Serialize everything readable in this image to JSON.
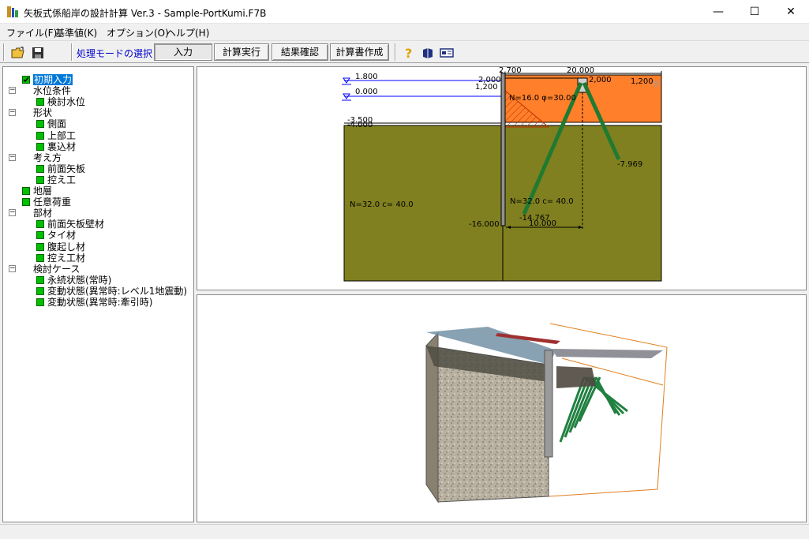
{
  "window": {
    "title": "矢板式係船岸の設計計算 Ver.3 - Sample-PortKumi.F7B",
    "minimize_glyph": "—",
    "maximize_glyph": "☐",
    "close_glyph": "✕"
  },
  "menu": [
    "ファイル(F)",
    "基準値(K)",
    "オプション(O)",
    "ヘルプ(H)"
  ],
  "toolbar": {
    "mode_label": "処理モードの選択",
    "buttons": [
      "入力",
      "計算実行",
      "結果確認",
      "計算書作成"
    ],
    "active_button": "入力"
  },
  "tree": [
    {
      "label": "初期入力",
      "level": 0,
      "type": "check",
      "selected": true
    },
    {
      "label": "水位条件",
      "level": 0,
      "type": "folder"
    },
    {
      "label": "検討水位",
      "level": 1,
      "type": "item"
    },
    {
      "label": "形状",
      "level": 0,
      "type": "folder"
    },
    {
      "label": "側面",
      "level": 1,
      "type": "item"
    },
    {
      "label": "上部工",
      "level": 1,
      "type": "item"
    },
    {
      "label": "裏込材",
      "level": 1,
      "type": "item"
    },
    {
      "label": "考え方",
      "level": 0,
      "type": "folder"
    },
    {
      "label": "前面矢板",
      "level": 1,
      "type": "item"
    },
    {
      "label": "控え工",
      "level": 1,
      "type": "item"
    },
    {
      "label": "地層",
      "level": 0,
      "type": "item"
    },
    {
      "label": "任意荷重",
      "level": 0,
      "type": "item"
    },
    {
      "label": "部材",
      "level": 0,
      "type": "folder"
    },
    {
      "label": "前面矢板壁材",
      "level": 1,
      "type": "item"
    },
    {
      "label": "タイ材",
      "level": 1,
      "type": "item"
    },
    {
      "label": "腹起し材",
      "level": 1,
      "type": "item"
    },
    {
      "label": "控え工材",
      "level": 1,
      "type": "item"
    },
    {
      "label": "検討ケース",
      "level": 0,
      "type": "folder"
    },
    {
      "label": "永続状態(常時)",
      "level": 1,
      "type": "item"
    },
    {
      "label": "変動状態(異常時:レベル1地震動)",
      "level": 1,
      "type": "item"
    },
    {
      "label": "変動状態(異常時:牽引時)",
      "level": 1,
      "type": "item"
    }
  ],
  "drawing": {
    "dim_top_left": "2,700",
    "dim_top_right": "20,000",
    "dim_left_2000": "2,000",
    "dim_left_1200": "1,200",
    "dim_right_2000": "2,000",
    "dim_right_1200": "1,200",
    "level_1800": "1.800",
    "level_0000": "0.000",
    "level_3500": "-3.500",
    "level_4000": "-4.000",
    "level_16000": "-16.000",
    "level_7969": "-7.969",
    "level_14767": "-14.767",
    "dim_10000": "10.000",
    "soil_upper": "N=16.0  φ=30.00",
    "soil_left": "N=32.0 c=  40.0",
    "soil_right": "N=32.0 c=  40.0",
    "colors": {
      "backfill": "#ff7f2a",
      "ground": "#808020",
      "anchor_pile": "#207a30",
      "water_line": "#0000ff"
    }
  }
}
